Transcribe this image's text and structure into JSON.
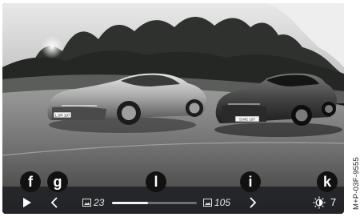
{
  "photo": {
    "description_icon": "slideshow-photo",
    "plate_left": "L.SR 197",
    "plate_right": "S.MC 197"
  },
  "controls": {
    "play_icon": "play-icon",
    "prev_icon": "chevron-left-icon",
    "next_icon": "chevron-right-icon",
    "brightness_icon": "brightness-icon",
    "current_index": "23",
    "total_count": "105",
    "progress_fraction": 0.42,
    "brightness_value": "7"
  },
  "callouts": {
    "f": "f",
    "g": "g",
    "l": "l",
    "i": "i",
    "k": "k"
  },
  "figure_id": "M+P-03F-9555",
  "colors": {
    "bar_bg": "#1c1e22",
    "callout_bg": "#111111",
    "progress_fill": "#f2f2f2",
    "progress_track": "#6d6f73"
  }
}
